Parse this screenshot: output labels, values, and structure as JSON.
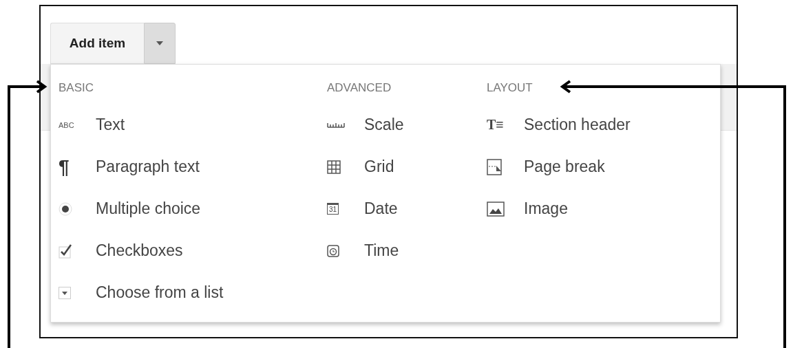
{
  "add_button": {
    "label": "Add item",
    "expanded": true
  },
  "menu": {
    "columns": [
      {
        "heading": "BASIC",
        "items": [
          {
            "kind": "abc",
            "icon_text": "ABC",
            "label": "Text"
          },
          {
            "kind": "pilcrow",
            "icon_text": "¶",
            "label": "Paragraph text"
          },
          {
            "kind": "radio",
            "label": "Multiple choice"
          },
          {
            "kind": "check",
            "label": "Checkboxes"
          },
          {
            "kind": "list",
            "label": "Choose from a list"
          }
        ]
      },
      {
        "heading": "ADVANCED",
        "items": [
          {
            "kind": "scale",
            "label": "Scale"
          },
          {
            "kind": "grid",
            "label": "Grid"
          },
          {
            "kind": "date",
            "icon_text": "31",
            "label": "Date"
          },
          {
            "kind": "time",
            "label": "Time"
          }
        ]
      },
      {
        "heading": "LAYOUT",
        "items": [
          {
            "kind": "section",
            "icon_text": "T≡",
            "label": "Section header"
          },
          {
            "kind": "pagebreak",
            "label": "Page break"
          },
          {
            "kind": "image",
            "label": "Image"
          }
        ]
      }
    ]
  }
}
